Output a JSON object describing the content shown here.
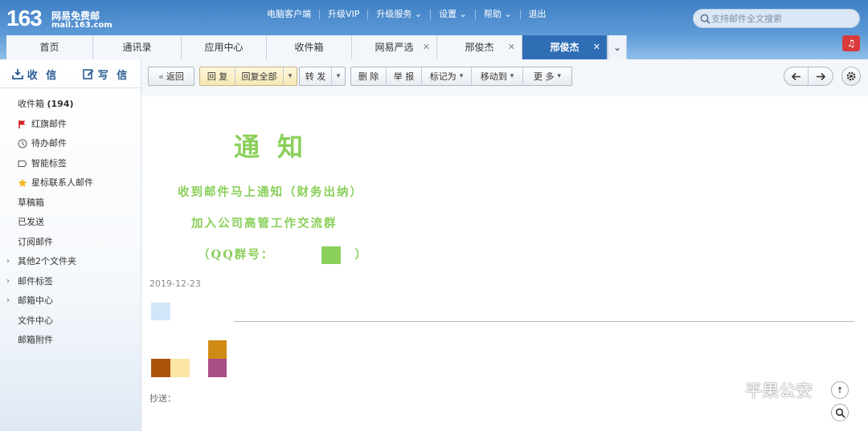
{
  "header": {
    "logo_number": "163",
    "logo_brand": "网易免费邮",
    "logo_domain": "mail.163.com",
    "links": [
      "电脑客户端",
      "升级VIP",
      "升级服务",
      "设置",
      "帮助",
      "退出"
    ],
    "search_placeholder": "支持邮件全文搜索"
  },
  "tabs": [
    {
      "label": "首页",
      "closable": false,
      "active": false
    },
    {
      "label": "通讯录",
      "closable": false,
      "active": false
    },
    {
      "label": "应用中心",
      "closable": false,
      "active": false
    },
    {
      "label": "收件箱",
      "closable": false,
      "active": false
    },
    {
      "label": "网易严选",
      "closable": true,
      "active": false
    },
    {
      "label": "邢俊杰",
      "closable": true,
      "active": false
    },
    {
      "label": "邢俊杰",
      "closable": true,
      "active": true
    }
  ],
  "sidebar": {
    "receive_label": "收 信",
    "write_label": "写 信",
    "folders": [
      {
        "label": "收件箱",
        "count": "(194)",
        "icon": ""
      },
      {
        "label": "红旗邮件",
        "icon": "red-flag-icon"
      },
      {
        "label": "待办邮件",
        "icon": "clock-icon"
      },
      {
        "label": "智能标签",
        "icon": "tag-icon"
      },
      {
        "label": "星标联系人邮件",
        "icon": "star-icon"
      },
      {
        "label": "草稿箱",
        "icon": ""
      },
      {
        "label": "已发送",
        "icon": ""
      },
      {
        "label": "订阅邮件",
        "icon": ""
      },
      {
        "label": "其他2个文件夹",
        "icon": "",
        "expandable": true
      },
      {
        "label": "邮件标签",
        "icon": "",
        "expandable": true
      },
      {
        "label": "邮箱中心",
        "icon": "",
        "expandable": true
      },
      {
        "label": "文件中心",
        "icon": ""
      },
      {
        "label": "邮箱附件",
        "icon": ""
      }
    ]
  },
  "toolbar": {
    "back": "返回",
    "reply": "回 复",
    "reply_all": "回复全部",
    "forward": "转 发",
    "delete": "删 除",
    "report": "举 报",
    "mark_as": "标记为",
    "move_to": "移动到",
    "more": "更 多"
  },
  "email": {
    "title": "通知",
    "line1": "收到邮件马上通知（财务出纳）",
    "line2": "加入公司高管工作交流群",
    "line3_prefix": "（QQ群号：",
    "line3_suffix": "）",
    "date": "2019-12-23",
    "cc_label": "抄送：",
    "accent_color": "#8bcf5b"
  },
  "watermark": "平果公安"
}
